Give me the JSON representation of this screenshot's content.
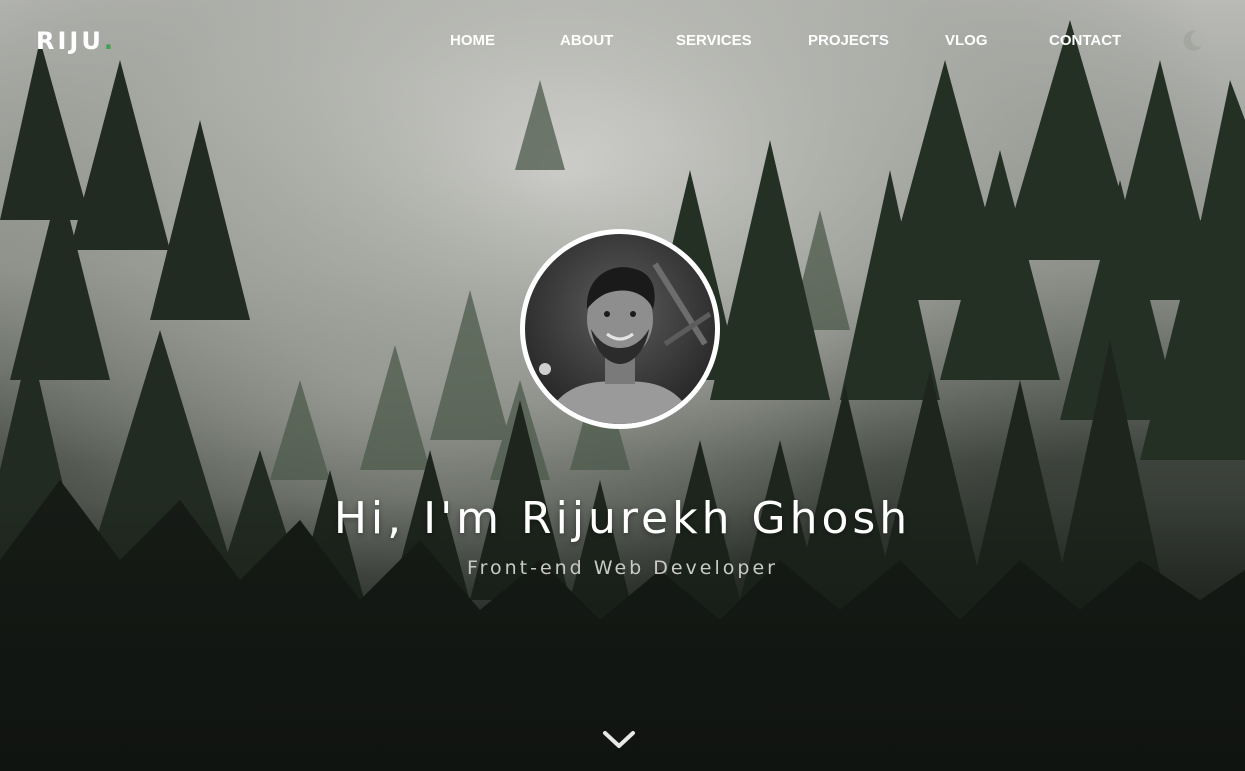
{
  "theme": {
    "accent": "#3fa34d",
    "text": "#ffffff",
    "subtext": "#c9c9c9"
  },
  "navbar": {
    "brand": "RIJU",
    "brand_dot": ".",
    "links": [
      {
        "label": "HOME"
      },
      {
        "label": "ABOUT"
      },
      {
        "label": "SERVICES"
      },
      {
        "label": "PROJECTS"
      },
      {
        "label": "VLOG"
      },
      {
        "label": "CONTACT"
      }
    ],
    "theme_toggle_icon": "moon-icon"
  },
  "hero": {
    "background": "misty-pine-forest",
    "avatar": "profile-photo",
    "title": "Hi, I'm Rijurekh Ghosh",
    "subtitle": "Front-end Web Developer",
    "scroll_icon": "chevron-down-icon"
  }
}
